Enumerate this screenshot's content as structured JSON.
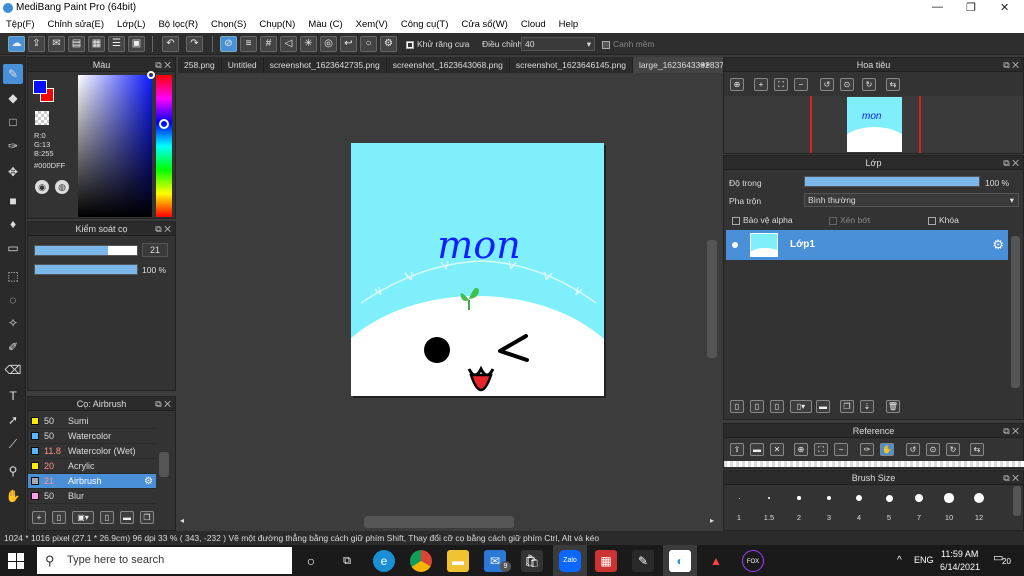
{
  "window": {
    "title": "MediBang Paint Pro (64bit)",
    "minimize": "—",
    "maximize": "❐",
    "close": "✕"
  },
  "menu": [
    "Tệp(F)",
    "Chỉnh sửa(E)",
    "Lớp(L)",
    "Bộ lọc(R)",
    "Chọn(S)",
    "Chụp(N)",
    "Màu (C)",
    "Xem(V)",
    "Công cụ(T)",
    "Cửa sổ(W)",
    "Cloud",
    "Help"
  ],
  "toolbar": {
    "antialias_label": "Khử răng cưa",
    "correction_label": "Điều chỉnh",
    "correction_value": "40",
    "snap_label": "Canh mềm"
  },
  "tabs": [
    "258.png",
    "Untitled",
    "screenshot_1623642735.png",
    "screenshot_1623643068.png",
    "screenshot_1623646145.png",
    "large_1623643302837.png"
  ],
  "color_panel": {
    "title": "Màu",
    "r": "R:0",
    "g": "G:13",
    "b": "B:255",
    "hex": "#000DFF",
    "primary": "#000DFF",
    "secondary": "#FF0000"
  },
  "brush_control": {
    "title": "Kiểm soát cọ",
    "size": "21",
    "opacity": "100 %",
    "size_level": 0.72,
    "opacity_level": 1.0
  },
  "brush_list": {
    "title": "Cọ: Airbrush",
    "items": [
      {
        "size": "50",
        "name": "Sumi",
        "color": "#ffeb00"
      },
      {
        "size": "50",
        "name": "Watercolor",
        "color": "#5ab4ff"
      },
      {
        "size": "11.8",
        "name": "Watercolor (Wet)",
        "color": "#5ab4ff"
      },
      {
        "size": "20",
        "name": "Acrylic",
        "color": "#ffeb00"
      },
      {
        "size": "21",
        "name": "Airbrush",
        "color": "#aaaaaa"
      },
      {
        "size": "50",
        "name": "Blur",
        "color": "#ff9ee0"
      }
    ]
  },
  "canvas": {
    "text": "mon",
    "bg": "#7ff0fb"
  },
  "navigator": {
    "title": "Hoa tiêu"
  },
  "layer_panel": {
    "title": "Lớp",
    "opacity_label": "Độ trong",
    "opacity_value": "100 %",
    "opacity_level": 1.0,
    "blend_label": "Pha trộn",
    "blend_value": "Bình thường",
    "protect_alpha": "Bảo vệ alpha",
    "clip": "Xén bớt",
    "lock": "Khóa",
    "layer_name": "Lớp1"
  },
  "reference": {
    "title": "Reference"
  },
  "brush_size": {
    "title": "Brush Size",
    "sizes": [
      "1",
      "1.5",
      "2",
      "3",
      "4",
      "5",
      "7",
      "10",
      "12"
    ]
  },
  "status": {
    "text": "1024 * 1016 pixel  (27.1 * 26.9cm)  96 dpi  33 %  ( 343, -232 )  Vẽ một đường thẳng bằng cách giữ phím Shift, Thay đổi cỡ cọ bằng cách giữ phím Ctrl, Alt và kéo"
  },
  "taskbar": {
    "search_placeholder": "Type here to search",
    "lang": "ENG",
    "time": "11:59 AM",
    "date": "6/14/2021",
    "notif_count": "20",
    "mail_badge": "9"
  }
}
